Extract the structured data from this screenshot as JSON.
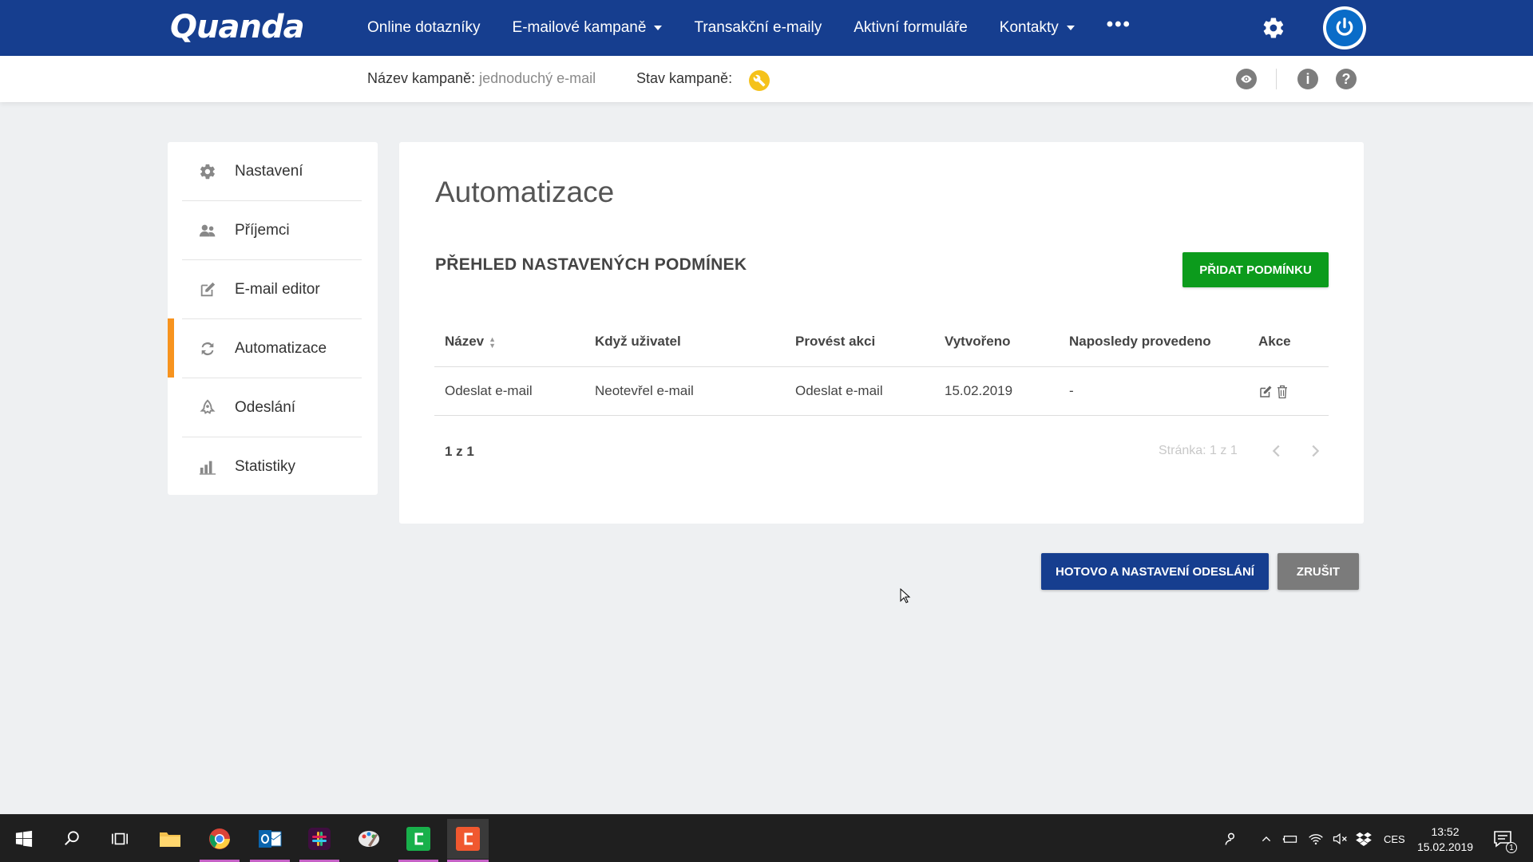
{
  "brand": {
    "logo_text": "Quanda"
  },
  "nav": {
    "items": [
      {
        "label": "Online dotazníky",
        "has_dropdown": false
      },
      {
        "label": "E-mailové kampaně",
        "has_dropdown": true
      },
      {
        "label": "Transakční e-maily",
        "has_dropdown": false
      },
      {
        "label": "Aktivní formuláře",
        "has_dropdown": false
      },
      {
        "label": "Kontakty",
        "has_dropdown": true
      }
    ],
    "more_label": "•••",
    "settings_icon": "gear-icon",
    "power_icon": "power-icon"
  },
  "campaign": {
    "name_label": "Název kampaně:",
    "name_value": "jednoduchý e-mail",
    "status_label": "Stav kampaně:",
    "status_icon": "wrench-icon"
  },
  "subbar_icons": [
    "eye-icon",
    "info-icon",
    "help-icon"
  ],
  "sidebar": {
    "items": [
      {
        "label": "Nastavení",
        "icon": "gear-icon",
        "active": false
      },
      {
        "label": "Příjemci",
        "icon": "users-icon",
        "active": false
      },
      {
        "label": "E-mail editor",
        "icon": "edit-icon",
        "active": false
      },
      {
        "label": "Automatizace",
        "icon": "refresh-icon",
        "active": true
      },
      {
        "label": "Odeslání",
        "icon": "send-icon",
        "active": false
      },
      {
        "label": "Statistiky",
        "icon": "bar-chart-icon",
        "active": false
      }
    ],
    "active_color": "#f7931e"
  },
  "main": {
    "title": "Automatizace",
    "section_title": "PŘEHLED NASTAVENÝCH PODMÍNEK",
    "add_button": "PŘIDAT PODMÍNKU",
    "table": {
      "columns": [
        "Název",
        "Když uživatel",
        "Provést akci",
        "Vytvořeno",
        "Naposledy provedeno",
        "Akce"
      ],
      "rows": [
        [
          "Odeslat e-mail",
          "Neotevřel e-mail",
          "Odeslat e-mail",
          "15.02.2019",
          "-",
          ""
        ]
      ]
    },
    "pager": {
      "count_text": "1 z 1",
      "page_text": "Stránka: 1 z 1"
    }
  },
  "footer_buttons": {
    "done": "HOTOVO A NASTAVENÍ ODESLÁNÍ",
    "cancel": "ZRUŠIT"
  },
  "taskbar": {
    "language": "CES",
    "time": "13:52",
    "date": "15.02.2019",
    "notification_count": "1"
  },
  "colors": {
    "nav_bg": "#163e8f",
    "accent_green": "#0c9b1c",
    "accent_orange": "#f7931e",
    "status_yellow": "#f5c21b"
  }
}
